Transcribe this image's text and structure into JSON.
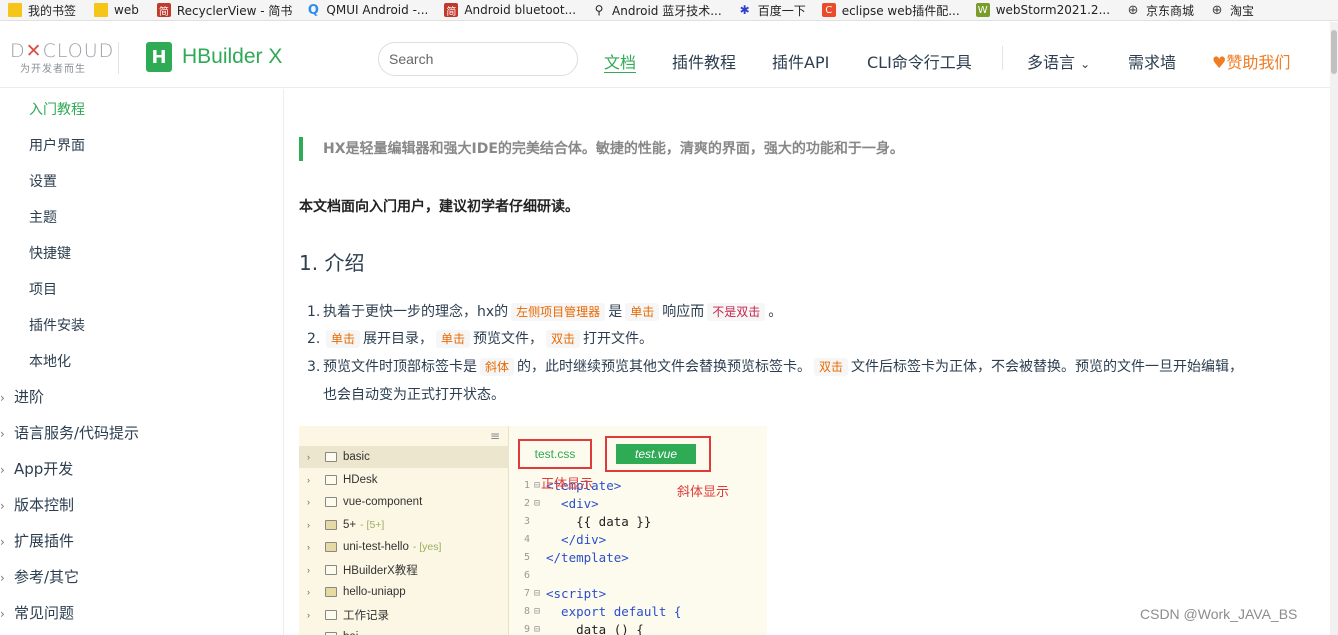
{
  "bookmarks": [
    {
      "label": "我的书签",
      "icon": "folder-icon"
    },
    {
      "label": "web",
      "icon": "folder-icon"
    },
    {
      "label": "RecyclerView - 简书",
      "icon": "jianshu-icon"
    },
    {
      "label": "QMUI Android -...",
      "icon": "qmui-icon"
    },
    {
      "label": "Android bluetoot...",
      "icon": "jianshu-icon"
    },
    {
      "label": "Android 蓝牙技术...",
      "icon": "github-icon"
    },
    {
      "label": "百度一下",
      "icon": "baidu-icon"
    },
    {
      "label": "eclipse web插件配...",
      "icon": "csdn-icon"
    },
    {
      "label": "webStorm2021.2...",
      "icon": "webstorm-icon"
    },
    {
      "label": "京东商城",
      "icon": "globe-icon"
    },
    {
      "label": "淘宝",
      "icon": "globe-icon"
    }
  ],
  "header": {
    "dcloud_slogan": "为开发者而生",
    "product_name": "HBuilder X",
    "search_placeholder": "Search",
    "nav": [
      "文档",
      "插件教程",
      "插件API",
      "CLI命令行工具",
      "多语言",
      "需求墙",
      "赞助我们"
    ]
  },
  "sidebar": {
    "sub_items": [
      "入门教程",
      "用户界面",
      "设置",
      "主题",
      "快捷键",
      "项目",
      "插件安装",
      "本地化"
    ],
    "groups": [
      "进阶",
      "语言服务/代码提示",
      "App开发",
      "版本控制",
      "扩展插件",
      "参考/其它",
      "常见问题"
    ]
  },
  "content": {
    "quote": "HX是轻量编辑器和强大IDE的完美结合体。敏捷的性能，清爽的界面，强大的功能和于一身。",
    "intro": "本文档面向入门用户，建议初学者仔细研读。",
    "heading": "1. 介绍",
    "list": {
      "n1": "1.",
      "n2": "2.",
      "n3": "3.",
      "item1": {
        "a": "执着于更快一步的理念，hx的",
        "c1": "左侧项目管理器",
        "b": "是",
        "c2": "单击",
        "d": "响应而",
        "c3": "不是双击",
        "e": "。"
      },
      "item2": {
        "c1": "单击",
        "a": "展开目录，",
        "c2": "单击",
        "b": "预览文件，",
        "c3": "双击",
        "c": "打开文件。"
      },
      "item3": {
        "a": "预览文件时顶部标签卡是",
        "c1": "斜体",
        "b": "的，此时继续预览其他文件会替换预览标签卡。",
        "c2": "双击",
        "c": "文件后标签卡为正体，不会被替换。预览的文件一旦开始编辑，",
        "d": "也会自动变为正式打开状态。"
      }
    }
  },
  "screenshot": {
    "tree": [
      {
        "name": "basic",
        "meta": ""
      },
      {
        "name": "HDesk",
        "meta": ""
      },
      {
        "name": "vue-component",
        "meta": ""
      },
      {
        "name": "5+",
        "meta": "- [5+]"
      },
      {
        "name": "uni-test-hello",
        "meta": "- [yes]"
      },
      {
        "name": "HBuilderX教程",
        "meta": ""
      },
      {
        "name": "hello-uniapp",
        "meta": ""
      },
      {
        "name": "工作记录",
        "meta": ""
      },
      {
        "name": "bai",
        "meta": ""
      }
    ],
    "tab_normal": "test.css",
    "tab_italic": "test.vue",
    "annotation_normal": "正体显示",
    "annotation_italic": "斜体显示",
    "code_lines": [
      {
        "n": "1",
        "fold": "⊟",
        "text": "<template>"
      },
      {
        "n": "2",
        "fold": "⊟",
        "text": "  <div>"
      },
      {
        "n": "3",
        "fold": "",
        "text": "    {{ data }}"
      },
      {
        "n": "4",
        "fold": "",
        "text": "  </div>"
      },
      {
        "n": "5",
        "fold": "",
        "text": "</template>"
      },
      {
        "n": "6",
        "fold": "",
        "text": ""
      },
      {
        "n": "7",
        "fold": "⊟",
        "text": "<script>"
      },
      {
        "n": "8",
        "fold": "⊟",
        "text": "  export default {"
      },
      {
        "n": "9",
        "fold": "⊟",
        "text": "    data () {"
      }
    ]
  },
  "watermark": "CSDN @Work_JAVA_BS",
  "colors": {
    "brand_green": "#2faa55",
    "sponsor_orange": "#f07c23",
    "annotation_red": "#e03a3a"
  }
}
